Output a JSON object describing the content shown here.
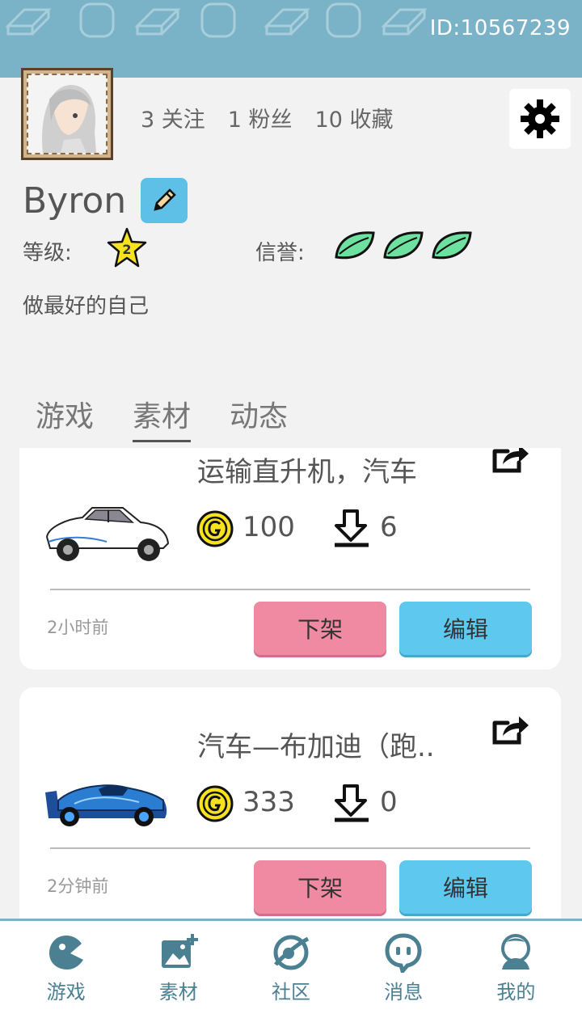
{
  "header": {
    "user_id": "ID:10567239",
    "bg_color": "#7ab3c8"
  },
  "profile": {
    "stats": {
      "following": "3 关注",
      "followers": "1 粉丝",
      "favorites": "10 收藏"
    },
    "username": "Byron",
    "level_label": "等级:",
    "level_value": "2",
    "reputation_label": "信誉:",
    "reputation_leaves": 3,
    "bio": "做最好的自己"
  },
  "tabs": [
    {
      "label": "游戏",
      "active": false
    },
    {
      "label": "素材",
      "active": true
    },
    {
      "label": "动态",
      "active": false
    }
  ],
  "items": [
    {
      "title": "运输直升机，汽车",
      "price": "100",
      "downloads": "6",
      "time": "2小时前",
      "unlist_label": "下架",
      "edit_label": "编辑"
    },
    {
      "title": "汽车—布加迪（跑..",
      "price": "333",
      "downloads": "0",
      "time": "2分钟前",
      "unlist_label": "下架",
      "edit_label": "编辑"
    }
  ],
  "bottom_nav": [
    {
      "label": "游戏",
      "icon": "game-icon"
    },
    {
      "label": "素材",
      "icon": "image-add-icon"
    },
    {
      "label": "社区",
      "icon": "planet-icon"
    },
    {
      "label": "消息",
      "icon": "chat-bubble-icon"
    },
    {
      "label": "我的",
      "icon": "profile-icon"
    }
  ],
  "colors": {
    "accent": "#7ab3c8",
    "unlist_button": "#ef8aa2",
    "edit_button": "#5ec8ef",
    "coin": "#f7e21e",
    "leaf": "#6ee0a0"
  }
}
